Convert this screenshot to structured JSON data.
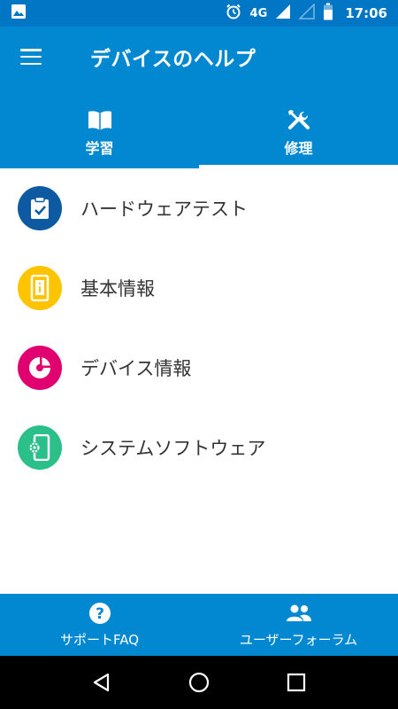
{
  "status_bar": {
    "network": "4G",
    "time": "17:06",
    "icons": [
      "image-notification-icon",
      "alarm-icon",
      "signal-icon",
      "signal-empty-icon",
      "battery-icon"
    ]
  },
  "app_bar": {
    "title": "デバイスのヘルプ",
    "color": "#0288d1",
    "tabs": [
      {
        "label": "学習",
        "icon": "book-icon",
        "selected": false
      },
      {
        "label": "修理",
        "icon": "tools-icon",
        "selected": true
      }
    ]
  },
  "list": {
    "items": [
      {
        "label": "ハードウェアテスト",
        "icon": "clipboard-check-icon",
        "color": "#0d5aa3"
      },
      {
        "label": "基本情報",
        "icon": "phone-info-icon",
        "color": "#ffc400"
      },
      {
        "label": "デバイス情報",
        "icon": "pie-chart-icon",
        "color": "#e0006f"
      },
      {
        "label": "システムソフトウェア",
        "icon": "phone-settings-icon",
        "color": "#2bbf8a"
      }
    ]
  },
  "bottom_bar": {
    "items": [
      {
        "label": "サポートFAQ",
        "icon": "help-circle-icon"
      },
      {
        "label": "ユーザーフォーラム",
        "icon": "people-icon"
      }
    ]
  },
  "nav_bar": {
    "buttons": [
      "back-icon",
      "home-icon",
      "recents-icon"
    ]
  }
}
